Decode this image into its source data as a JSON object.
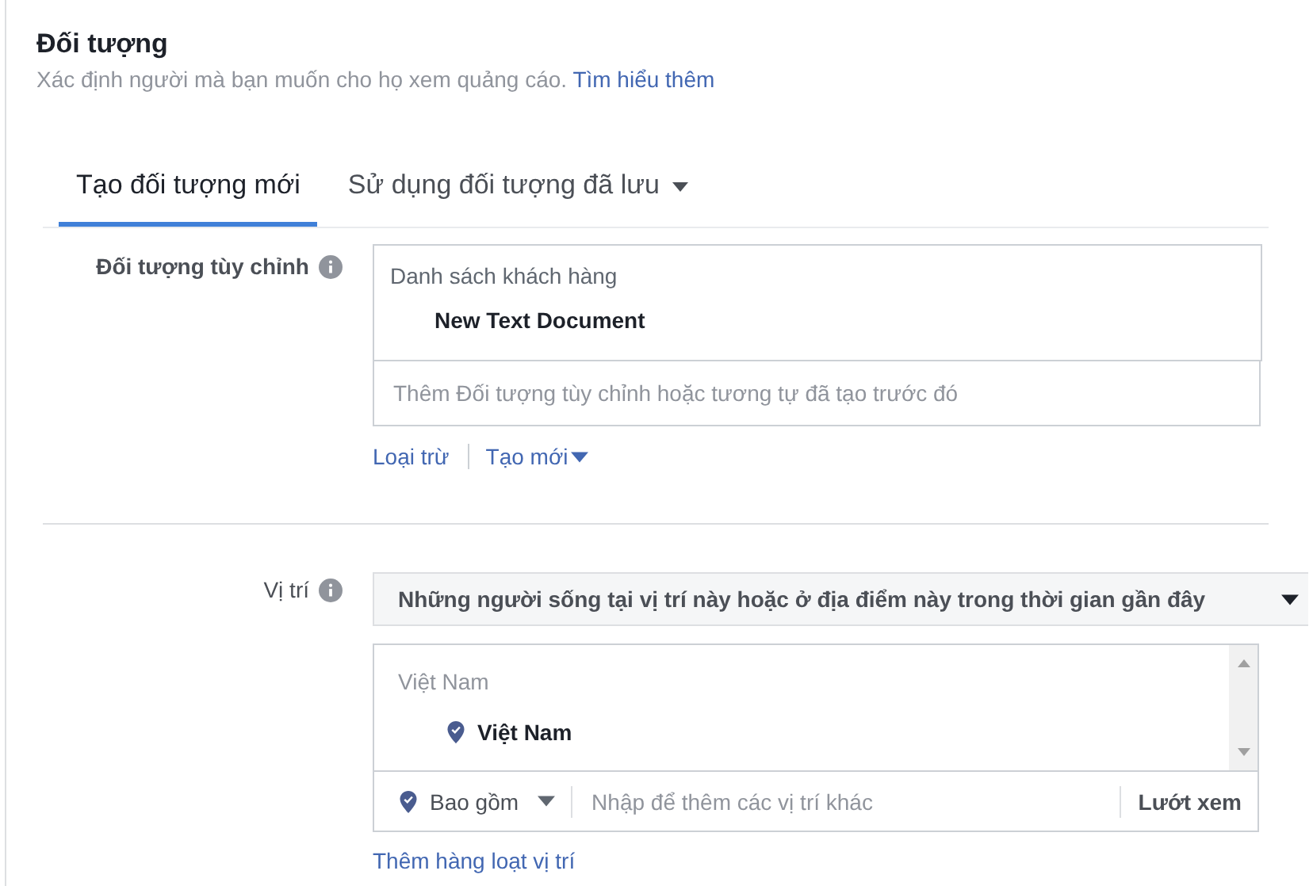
{
  "section": {
    "title": "Đối tượng",
    "description": "Xác định người mà bạn muốn cho họ xem quảng cáo.",
    "learn_more": "Tìm hiểu thêm"
  },
  "tabs": [
    {
      "label": "Tạo đối tượng mới",
      "selected": true,
      "caret": false
    },
    {
      "label": "Sử dụng đối tượng đã lưu",
      "selected": false,
      "caret": true
    }
  ],
  "custom_audience": {
    "label": "Đối tượng tùy chỉnh",
    "list_heading": "Danh sách khách hàng",
    "items": [
      "New Text Document"
    ],
    "placeholder": "Thêm Đối tượng tùy chỉnh hoặc tương tự đã tạo trước đó",
    "links": [
      {
        "label": "Loại trừ",
        "caret": false
      },
      {
        "label": "Tạo mới",
        "caret": true
      }
    ]
  },
  "location": {
    "label": "Vị trí",
    "mode": "Những người sống tại vị trí này hoặc ở địa điểm này trong thời gian gần đây",
    "list_heading": "Việt Nam",
    "items": [
      "Việt Nam"
    ],
    "include": "Bao gồm",
    "placeholder": "Nhập để thêm các vị trí khác",
    "browse": "Lướt xem",
    "bulk_link": "Thêm hàng loạt vị trí"
  }
}
